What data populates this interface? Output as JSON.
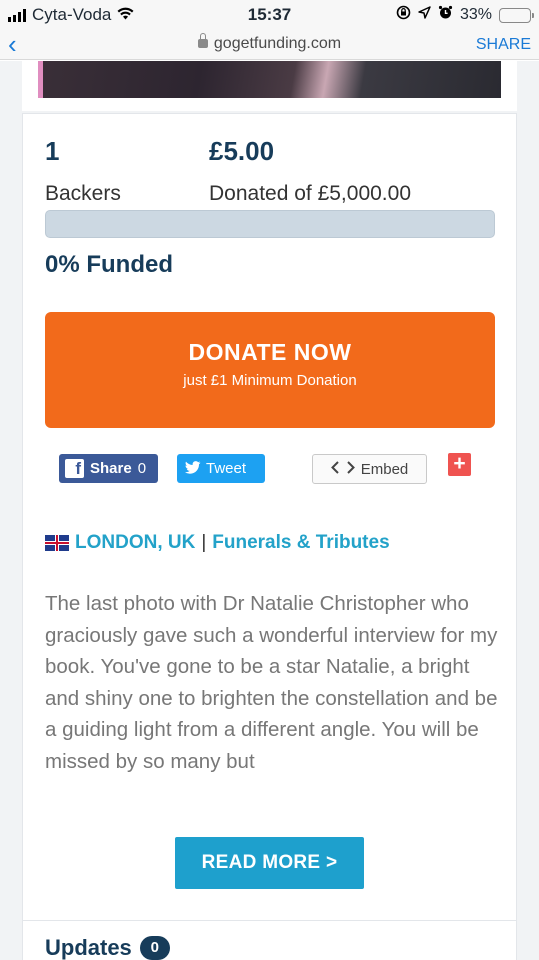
{
  "status_bar": {
    "carrier": "Cyta-Voda",
    "time": "15:37",
    "battery": "33%",
    "battery_level": 0.33
  },
  "browser": {
    "url": "gogetfunding.com",
    "share_label": "SHARE"
  },
  "stats": {
    "backers_count": "1",
    "backers_label": "Backers",
    "donated_amount": "£5.00",
    "donated_label": "Donated of £5,000.00",
    "progress_fraction": 0.0,
    "funded_text": "0% Funded"
  },
  "donate": {
    "title": "DONATE NOW",
    "subtitle": "just £1 Minimum Donation"
  },
  "social": {
    "fb_label": "Share",
    "fb_count": "0",
    "tweet_label": "Tweet",
    "embed_label": "Embed",
    "plus_label": "+"
  },
  "location": {
    "city": "LONDON, UK",
    "separator": "|",
    "category": "Funerals & Tributes"
  },
  "description": "The last photo with Dr Natalie Christopher who graciously gave such a wonderful interview for my book. You've gone to be a star Natalie, a bright and shiny one to brighten the constellation and be a guiding light from a different angle. You will be missed by so many but",
  "read_more_label": "READ MORE >",
  "updates": {
    "title": "Updates",
    "count": "0"
  },
  "colors": {
    "donate": "#f26a1b",
    "accent": "#23a2c9",
    "heading": "#173c5a"
  }
}
